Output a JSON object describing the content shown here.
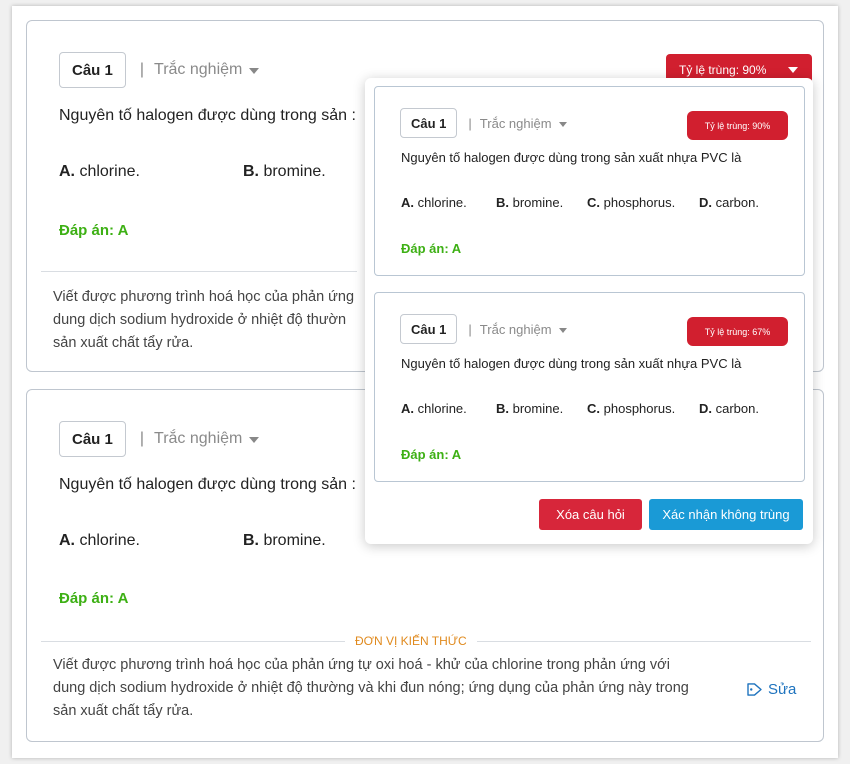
{
  "question": {
    "label": "Câu 1",
    "separator": "|",
    "type": "Trắc nghiệm",
    "text_truncated": "Nguyên tố halogen được dùng trong sản :",
    "text_full": "Nguyên tố halogen được dùng trong sản xuất nhựa PVC là",
    "options": [
      {
        "letter": "A.",
        "text": "chlorine."
      },
      {
        "letter": "B.",
        "text": "bromine."
      },
      {
        "letter": "C.",
        "text": "phosphorus."
      },
      {
        "letter": "D.",
        "text": "carbon."
      }
    ],
    "answer": "Đáp án: A"
  },
  "card1": {
    "dup_rate": "Tỷ lệ trùng: 90%",
    "knowledge_lines": [
      "Viết được phương trình hoá học của phản ứng",
      "dung dịch sodium hydroxide ở nhiệt độ thườn",
      "sản xuất chất tẩy rửa."
    ]
  },
  "card2": {
    "knowledge_label": "ĐƠN VỊ KIẾN THỨC",
    "knowledge_lines": [
      "Viết được phương trình hoá học của phản ứng tự oxi hoá - khử của chlorine trong phản ứng với",
      "dung dịch sodium hydroxide ở nhiệt độ thường và khi đun nóng; ứng dụng của phản ứng này trong",
      "sản xuất chất tẩy rửa."
    ],
    "edit_label": "Sửa"
  },
  "popup": {
    "items": [
      {
        "rate": "Tỷ lệ trùng: 90%"
      },
      {
        "rate": "Tỷ lệ trùng: 67%"
      }
    ],
    "delete_label": "Xóa câu hỏi",
    "confirm_label": "Xác nhận không trùng"
  },
  "colors": {
    "danger": "#d11f2f",
    "primary": "#1a9ad6",
    "answer": "#3db014",
    "knowledge": "#e08a1e",
    "link": "#1e73be"
  }
}
